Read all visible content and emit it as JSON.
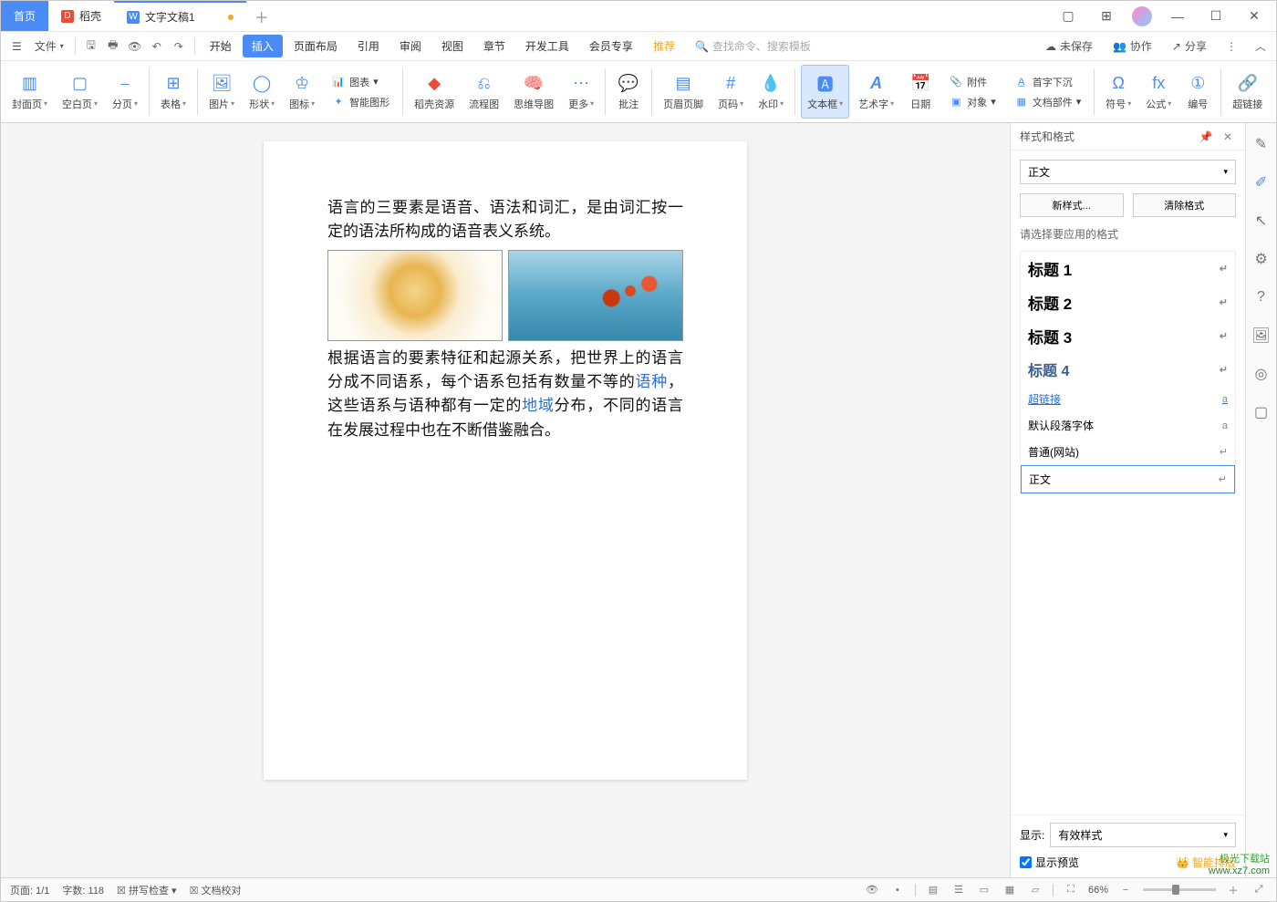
{
  "tabs": {
    "home": "首页",
    "docker": "稻壳",
    "doc": "文字文稿1"
  },
  "window_controls": {
    "min": "—",
    "max": "☐",
    "close": "✕"
  },
  "menubar": {
    "file": "文件",
    "items": [
      "开始",
      "插入",
      "页面布局",
      "引用",
      "审阅",
      "视图",
      "章节",
      "开发工具",
      "会员专享",
      "推荐"
    ],
    "active": "插入",
    "search_placeholder": "查找命令、搜索模板",
    "right": {
      "unsaved": "未保存",
      "collab": "协作",
      "share": "分享"
    }
  },
  "ribbon": {
    "cover": "封面页",
    "blank": "空白页",
    "pagebreak": "分页",
    "table": "表格",
    "picture": "图片",
    "shape": "形状",
    "icon": "图标",
    "chart": "图表",
    "smartshape": "智能图形",
    "docerres": "稻壳资源",
    "flowchart": "流程图",
    "mindmap": "思维导图",
    "more": "更多",
    "comment": "批注",
    "headerfooter": "页眉页脚",
    "pagenum": "页码",
    "watermark": "水印",
    "textbox": "文本框",
    "wordart": "艺术字",
    "date": "日期",
    "attachment": "附件",
    "object": "对象",
    "dropcap": "首字下沉",
    "docparts": "文档部件",
    "symbol": "符号",
    "equation": "公式",
    "number": "编号",
    "hyperlink": "超链接"
  },
  "document": {
    "p1_a": "语言的三要素是语音、语法和词汇，是由词汇按一定的语法所构成的语音表义系统。",
    "p2_a": "根据语言的要素特征和起源关系，把世界上的语言分成不同语系，每个语系包括有数量不等的",
    "p2_link1": "语种",
    "p2_b": "，这些语系与语种都有一定的",
    "p2_link2": "地域",
    "p2_c": "分布，不同的语言在发展过程中也在不断借鉴融合。"
  },
  "panel": {
    "title": "样式和格式",
    "current": "正文",
    "new_style": "新样式...",
    "clear": "清除格式",
    "hint": "请选择要应用的格式",
    "styles": [
      {
        "name": "标题 1",
        "cls": "h",
        "mark": "↵"
      },
      {
        "name": "标题 2",
        "cls": "h",
        "mark": "↵"
      },
      {
        "name": "标题 3",
        "cls": "h",
        "mark": "↵"
      },
      {
        "name": "标题 4",
        "cls": "h4",
        "mark": "↵"
      },
      {
        "name": "超链接",
        "cls": "lnk",
        "mark": "a"
      },
      {
        "name": "默认段落字体",
        "cls": "",
        "mark": "a"
      },
      {
        "name": "普通(网站)",
        "cls": "",
        "mark": "↵"
      },
      {
        "name": "正文",
        "cls": "sel2",
        "mark": "↵"
      }
    ],
    "show_label": "显示:",
    "show_value": "有效样式",
    "preview_label": "显示预览",
    "smart": "智能排版"
  },
  "statusbar": {
    "page": "页面: 1/1",
    "wordcount": "字数: 118",
    "spellcheck": "拼写检查",
    "proof": "文档校对",
    "zoom": "66%"
  },
  "watermark": {
    "l1": "极光下载站",
    "l2": "www.xz7.com"
  }
}
